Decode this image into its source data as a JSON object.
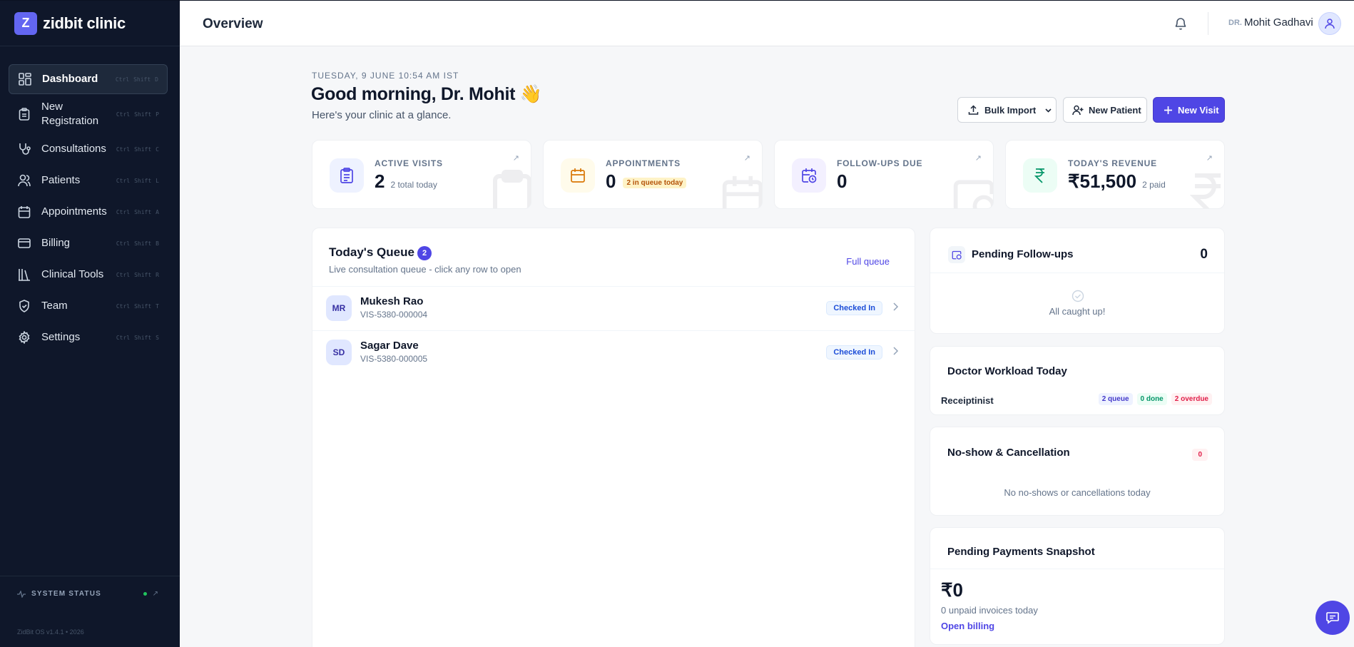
{
  "brand": {
    "mark": "Z",
    "name": "zidbit clinic"
  },
  "nav": [
    {
      "label": "Dashboard",
      "keys": [
        "Ctrl",
        "Shift",
        "D"
      ]
    },
    {
      "label": "New Registration",
      "keys": [
        "Ctrl",
        "Shift",
        "P"
      ]
    },
    {
      "label": "Consultations",
      "keys": [
        "Ctrl",
        "Shift",
        "C"
      ]
    },
    {
      "label": "Patients",
      "keys": [
        "Ctrl",
        "Shift",
        "L"
      ]
    },
    {
      "label": "Appointments",
      "keys": [
        "Ctrl",
        "Shift",
        "A"
      ]
    },
    {
      "label": "Billing",
      "keys": [
        "Ctrl",
        "Shift",
        "B"
      ]
    },
    {
      "label": "Clinical Tools",
      "keys": [
        "Ctrl",
        "Shift",
        "R"
      ]
    },
    {
      "label": "Team",
      "keys": [
        "Ctrl",
        "Shift",
        "T"
      ]
    },
    {
      "label": "Settings",
      "keys": [
        "Ctrl",
        "Shift",
        "S"
      ]
    }
  ],
  "system_status": {
    "label": "SYSTEM STATUS"
  },
  "version": "ZidBit OS v1.4.1 • 2026",
  "header": {
    "title": "Overview",
    "user_prefix": "DR.",
    "user_name": "Mohit Gadhavi"
  },
  "greeting": {
    "date": "TUESDAY, 9 JUNE 10:54 AM IST",
    "title": "Good morning, Dr. Mohit 👋",
    "subtitle": "Here's your clinic at a glance."
  },
  "actions": {
    "bulk_import": "Bulk Import",
    "new_patient": "New Patient",
    "new_visit": "New Visit"
  },
  "stats": [
    {
      "label": "ACTIVE VISITS",
      "value": "2",
      "note": "2 total today"
    },
    {
      "label": "APPOINTMENTS",
      "value": "0",
      "note": "2 in queue today"
    },
    {
      "label": "FOLLOW-UPS DUE",
      "value": "0",
      "note": ""
    },
    {
      "label": "TODAY'S REVENUE",
      "value": "₹51,500",
      "note": "2 paid"
    }
  ],
  "queue": {
    "title": "Today's Queue",
    "count": "2",
    "subtitle": "Live consultation queue - click any row to open",
    "link": "Full queue",
    "rows": [
      {
        "initials": "MR",
        "name": "Mukesh Rao",
        "id": "VIS-5380-000004",
        "status": "Checked In"
      },
      {
        "initials": "SD",
        "name": "Sagar Dave",
        "id": "VIS-5380-000005",
        "status": "Checked In"
      }
    ]
  },
  "followups": {
    "title": "Pending Follow-ups",
    "count": "0",
    "empty": "All caught up!"
  },
  "workload": {
    "title": "Doctor Workload Today",
    "row": {
      "name": "Receiptinist",
      "queue": "2 queue",
      "done": "0 done",
      "overdue": "2 overdue"
    }
  },
  "noshow": {
    "title": "No-show & Cancellation",
    "count": "0",
    "empty": "No no-shows or cancellations today"
  },
  "payments": {
    "title": "Pending Payments Snapshot",
    "amount": "₹0",
    "note": "0 unpaid invoices today",
    "link": "Open billing"
  },
  "colors": {
    "accent": "#4f46e5",
    "sidebar": "#0f172a",
    "success": "#16a34a",
    "danger": "#e11d48",
    "warning": "#b45309"
  },
  "icons": {
    "nav": [
      "dashboard-grid-icon",
      "clipboard-icon",
      "stethoscope-icon",
      "users-icon",
      "calendar-icon",
      "credit-card-icon",
      "library-icon",
      "shield-icon",
      "gear-icon"
    ],
    "header": [
      "bell-icon",
      "user-icon"
    ],
    "stats": [
      "clipboard-list-icon",
      "calendar-icon",
      "calendar-clock-icon",
      "rupee-icon"
    ]
  }
}
